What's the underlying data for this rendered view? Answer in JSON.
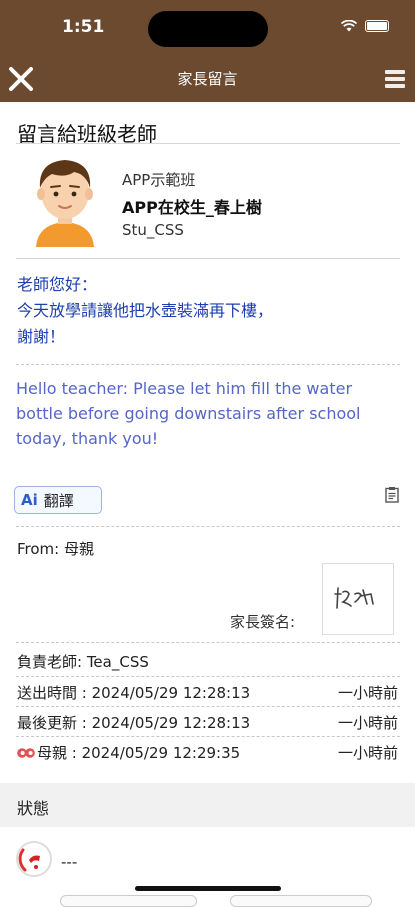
{
  "status_bar": {
    "time": "1:51"
  },
  "nav": {
    "title": "家長留言"
  },
  "page": {
    "title": "留言給班級老師"
  },
  "student": {
    "class_name": "APP示範班",
    "name": "APP在校生_春上樹",
    "id": "Stu_CSS"
  },
  "message": {
    "zh_line1": "老師您好：",
    "zh_line2": "今天放學請讓他把水壺裝滿再下樓，",
    "zh_line3": "謝謝！",
    "en": "Hello teacher: Please let him fill the water bottle before going downstairs after school today, thank you!"
  },
  "translate_button": {
    "logo": "Ai",
    "label": "翻譯"
  },
  "from": "From: 母親",
  "signature": {
    "label": "家長簽名:",
    "signature_text": "Kim"
  },
  "details": {
    "teacher": "負責老師: Tea_CSS",
    "sent_time": "送出時間 : 2024/05/29 12:28:13",
    "sent_ago": "一小時前",
    "updated_time": "最後更新 : 2024/05/29 12:28:13",
    "updated_ago": "一小時前",
    "read_by": "母親 : 2024/05/29 12:29:35",
    "read_ago": "一小時前"
  },
  "status_section": {
    "title": "狀態",
    "value": "---"
  },
  "colors": {
    "brand": "#6b4a2f",
    "message_zh": "#1f3fb0",
    "message_en": "#5565c8"
  }
}
